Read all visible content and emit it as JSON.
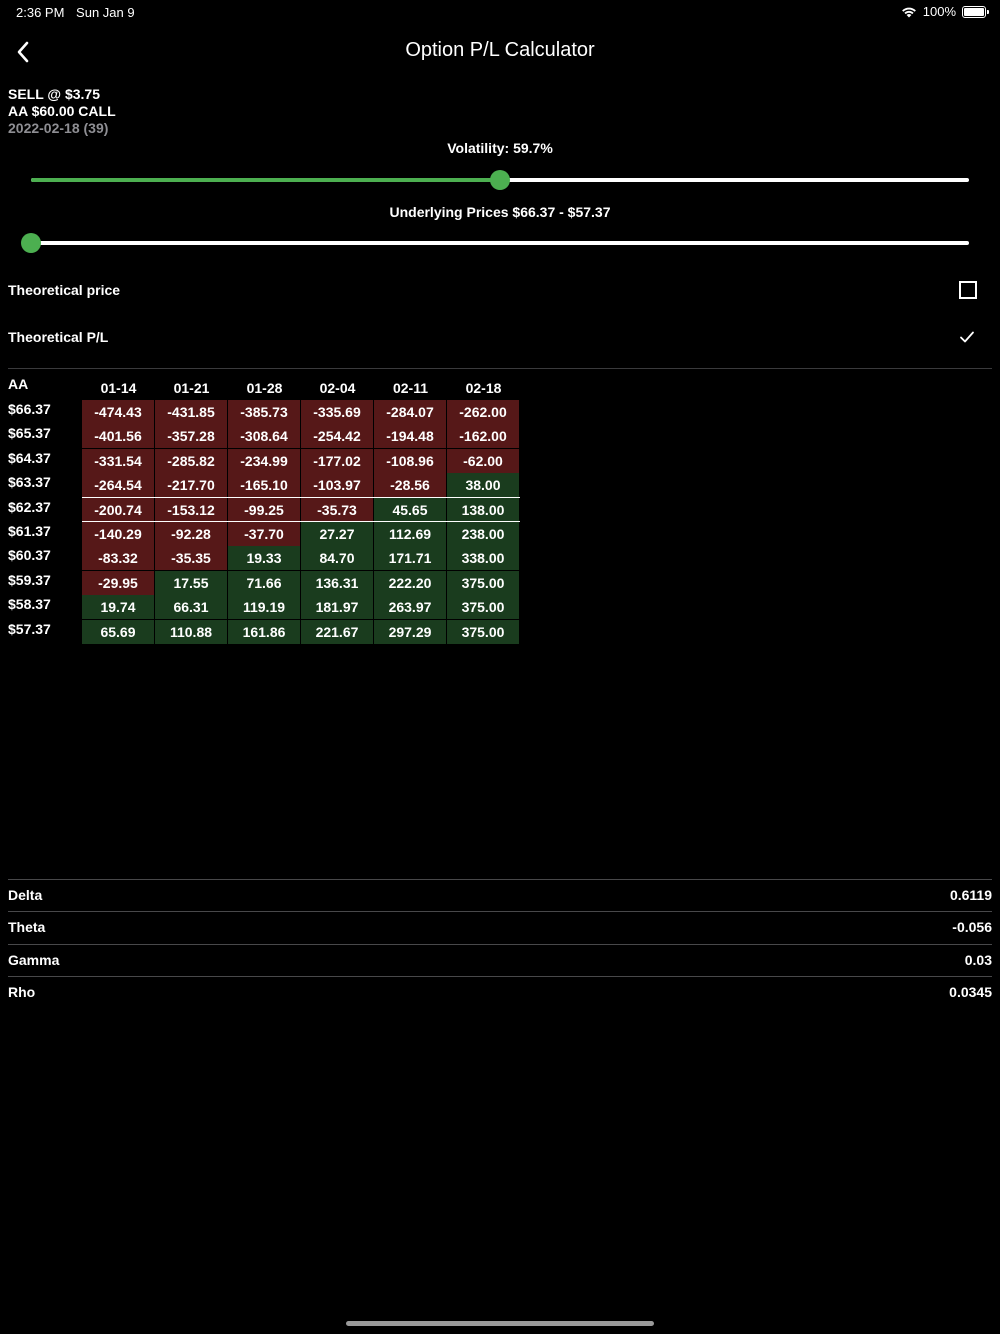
{
  "status": {
    "time": "2:36 PM",
    "date": "Sun Jan 9",
    "battery": "100%"
  },
  "nav": {
    "title": "Option P/L Calculator"
  },
  "order": {
    "side": "SELL @ $3.75",
    "contract": "AA $60.00 CALL",
    "expiry": "2022-02-18 (39)"
  },
  "volatility": {
    "label": "Volatility: 59.7%",
    "fraction": 0.5
  },
  "underlying": {
    "label": "Underlying Prices $66.37 - $57.37",
    "fraction": 0.0
  },
  "options": {
    "theoretical_price": {
      "label": "Theoretical price",
      "checked": false
    },
    "theoretical_pl": {
      "label": "Theoretical P/L",
      "checked": true
    }
  },
  "grid": {
    "symbol": "AA",
    "dates": [
      "01-14",
      "01-21",
      "01-28",
      "02-04",
      "02-11",
      "02-18"
    ],
    "prices": [
      "$66.37",
      "$65.37",
      "$64.37",
      "$63.37",
      "$62.37",
      "$61.37",
      "$60.37",
      "$59.37",
      "$58.37",
      "$57.37"
    ],
    "rows": [
      [
        "-474.43",
        "-431.85",
        "-385.73",
        "-335.69",
        "-284.07",
        "-262.00"
      ],
      [
        "-401.56",
        "-357.28",
        "-308.64",
        "-254.42",
        "-194.48",
        "-162.00"
      ],
      [
        "-331.54",
        "-285.82",
        "-234.99",
        "-177.02",
        "-108.96",
        "-62.00"
      ],
      [
        "-264.54",
        "-217.70",
        "-165.10",
        "-103.97",
        "-28.56",
        "38.00"
      ],
      [
        "-200.74",
        "-153.12",
        "-99.25",
        "-35.73",
        "45.65",
        "138.00"
      ],
      [
        "-140.29",
        "-92.28",
        "-37.70",
        "27.27",
        "112.69",
        "238.00"
      ],
      [
        "-83.32",
        "-35.35",
        "19.33",
        "84.70",
        "171.71",
        "338.00"
      ],
      [
        "-29.95",
        "17.55",
        "71.66",
        "136.31",
        "222.20",
        "375.00"
      ],
      [
        "19.74",
        "66.31",
        "119.19",
        "181.97",
        "263.97",
        "375.00"
      ],
      [
        "65.69",
        "110.88",
        "161.86",
        "221.67",
        "297.29",
        "375.00"
      ]
    ]
  },
  "greeks": [
    {
      "name": "Delta",
      "value": "0.6119"
    },
    {
      "name": "Theta",
      "value": "-0.056"
    },
    {
      "name": "Gamma",
      "value": "0.03"
    },
    {
      "name": "Rho",
      "value": "0.0345"
    }
  ],
  "colors": {
    "accent": "#4caf50",
    "loss_cell": "#561818",
    "profit_cell": "#1a3c1e"
  }
}
